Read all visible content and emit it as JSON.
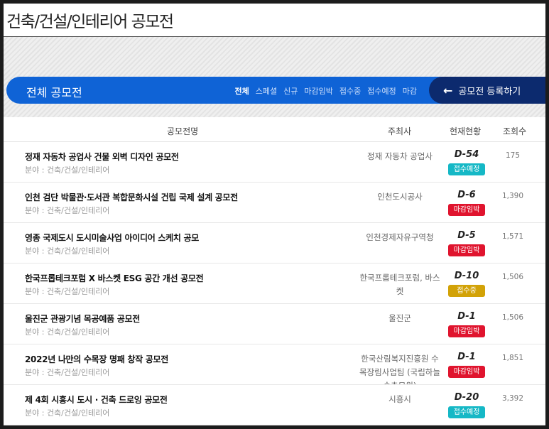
{
  "page": {
    "title": "건축/건설/인테리어 공모전"
  },
  "banner": {
    "title": "전체 공모전",
    "filters": [
      "전체",
      "스페셜",
      "신규",
      "마감임박",
      "접수중",
      "접수예정",
      "마감"
    ],
    "register_label": "공모전 등록하기",
    "register_icon": "arrow-left-icon"
  },
  "table": {
    "headers": {
      "name": "공모전명",
      "host": "주최사",
      "status": "현재현황",
      "views": "조회수"
    },
    "rows": [
      {
        "name": "정재 자동차 공업사 건물 외벽 디자인 공모전",
        "field": "분야 : 건축/건설/인테리어",
        "host": "정재 자동차 공업사",
        "dday": "D-54",
        "badge": "접수예정",
        "badge_type": "soon",
        "views": "175"
      },
      {
        "name": "인천 검단 박물관·도서관 복합문화시설 건립 국제 설계 공모전",
        "field": "분야 : 건축/건설/인테리어",
        "host": "인천도시공사",
        "dday": "D-6",
        "badge": "마감임박",
        "badge_type": "closing",
        "views": "1,390"
      },
      {
        "name": "영종 국제도시 도시미술사업 아이디어 스케치 공모",
        "field": "분야 : 건축/건설/인테리어",
        "host": "인천경제자유구역청",
        "dday": "D-5",
        "badge": "마감임박",
        "badge_type": "closing",
        "views": "1,571"
      },
      {
        "name": "한국프롭테크포럼 X 바스켓 ESG 공간 개선 공모전",
        "field": "분야 : 건축/건설/인테리어",
        "host": "한국프롭테크포럼, 바스켓",
        "dday": "D-10",
        "badge": "접수중",
        "badge_type": "open",
        "views": "1,506"
      },
      {
        "name": "울진군 관광기념 목공예품 공모전",
        "field": "분야 : 건축/건설/인테리어",
        "host": "울진군",
        "dday": "D-1",
        "badge": "마감임박",
        "badge_type": "closing",
        "views": "1,506"
      },
      {
        "name": "2022년 나만의 수목장 명패 창작 공모전",
        "field": "분야 : 건축/건설/인테리어",
        "host": "한국산림복지진흥원 수목장림사업팀 (국립하늘숲추모원)",
        "dday": "D-1",
        "badge": "마감임박",
        "badge_type": "closing",
        "views": "1,851"
      },
      {
        "name": "제 4회 시흥시 도시 · 건축 드로잉 공모전",
        "field": "분야 : 건축/건설/인테리어",
        "host": "시흥시",
        "dday": "D-20",
        "badge": "접수예정",
        "badge_type": "soon",
        "views": "3,392"
      }
    ]
  }
}
